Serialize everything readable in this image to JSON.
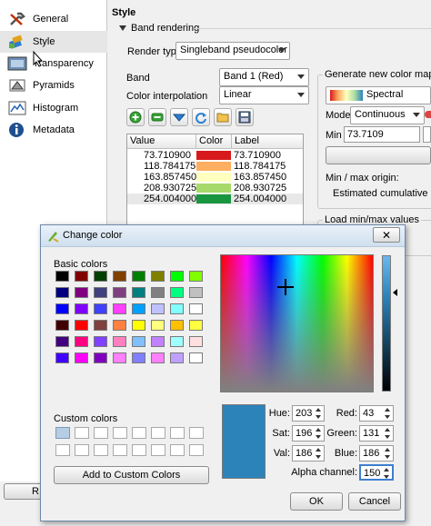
{
  "sidebar": {
    "items": [
      {
        "label": "General",
        "icon": "wrench-icon"
      },
      {
        "label": "Style",
        "icon": "paint-icon"
      },
      {
        "label": "Transparency",
        "icon": "transparency-icon"
      },
      {
        "label": "Pyramids",
        "icon": "pyramid-icon"
      },
      {
        "label": "Histogram",
        "icon": "histogram-icon"
      },
      {
        "label": "Metadata",
        "icon": "info-icon"
      }
    ]
  },
  "style": {
    "heading": "Style",
    "band_rendering": "Band rendering",
    "render_type_label": "Render type",
    "render_type_value": "Singleband pseudocolor",
    "band_label": "Band",
    "band_value": "Band 1 (Red)",
    "interp_label": "Color interpolation",
    "interp_value": "Linear",
    "table": {
      "headers": [
        "Value",
        "Color",
        "Label"
      ],
      "rows": [
        {
          "value": "73.710900",
          "color": "#d7191c",
          "label": "73.710900"
        },
        {
          "value": "118.784175",
          "color": "#fdae61",
          "label": "118.784175"
        },
        {
          "value": "163.857450",
          "color": "#ffffbf",
          "label": "163.857450"
        },
        {
          "value": "208.930725",
          "color": "#a6d96a",
          "label": "208.930725"
        },
        {
          "value": "254.004000",
          "color": "#1a9641",
          "label": "254.004000"
        }
      ]
    }
  },
  "colormap": {
    "title": "Generate new color map",
    "ramp_value": "Spectral",
    "mode_label": "Mode",
    "mode_value": "Continuous",
    "min_label": "Min",
    "min_value": "73.7109",
    "minmax_origin": "Min / max origin:",
    "origin_value": "Estimated cumulative cut",
    "load_minmax": "Load min/max values",
    "left_cut_btn": "R"
  },
  "dialog": {
    "title": "Change color",
    "basic_colors": "Basic colors",
    "custom_colors": "Custom colors",
    "add_custom": "Add to Custom Colors",
    "hue_label": "Hue:",
    "hue": "203",
    "sat_label": "Sat:",
    "sat": "196",
    "val_label": "Val:",
    "val": "186",
    "red_label": "Red:",
    "red": "43",
    "green_label": "Green:",
    "green": "131",
    "blue_label": "Blue:",
    "blue": "186",
    "alpha_label": "Alpha channel:",
    "alpha": "150",
    "ok": "OK",
    "cancel": "Cancel",
    "current_color": "#2b83ba",
    "basic_swatches": [
      "#000000",
      "#800000",
      "#004000",
      "#804000",
      "#008000",
      "#808000",
      "#00ff00",
      "#80ff00",
      "#000080",
      "#800080",
      "#404080",
      "#804080",
      "#008080",
      "#808080",
      "#00ff80",
      "#c0c0c0",
      "#0000ff",
      "#8000ff",
      "#4040ff",
      "#ff40ff",
      "#00a0ff",
      "#c0c0ff",
      "#80ffff",
      "#ffffff",
      "#400000",
      "#ff0000",
      "#804040",
      "#ff8040",
      "#ffff00",
      "#ffff80",
      "#ffc000",
      "#ffff40",
      "#400080",
      "#ff0080",
      "#8040ff",
      "#ff80c0",
      "#80c0ff",
      "#c080ff",
      "#a0ffff",
      "#ffe0e0",
      "#4000ff",
      "#ff00ff",
      "#8000c0",
      "#ff80ff",
      "#8080ff",
      "#ff80ff",
      "#c0a0ff",
      "#ffffff"
    ]
  }
}
